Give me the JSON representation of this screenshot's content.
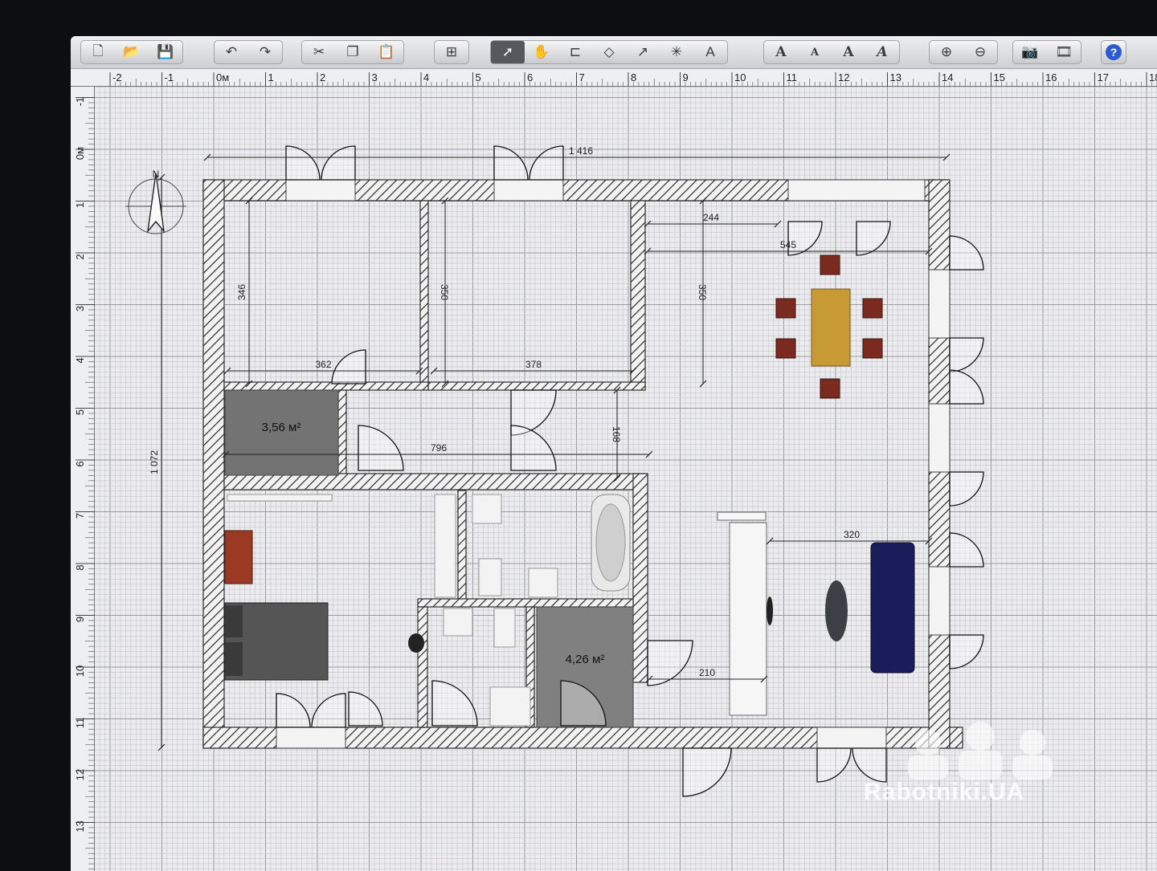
{
  "toolbar": {
    "groups": [
      {
        "name": "file",
        "buttons": [
          {
            "id": "new-plan-button",
            "icon": "new-document-icon",
            "glyph": "🗋"
          },
          {
            "id": "open-button",
            "icon": "folder-icon",
            "glyph": "📂"
          },
          {
            "id": "save-button",
            "icon": "save-icon",
            "glyph": "💾"
          }
        ]
      },
      {
        "name": "history",
        "buttons": [
          {
            "id": "undo-button",
            "icon": "undo-icon",
            "glyph": "↶"
          },
          {
            "id": "redo-button",
            "icon": "redo-icon",
            "glyph": "↷"
          }
        ]
      },
      {
        "name": "clipboard",
        "buttons": [
          {
            "id": "cut-button",
            "icon": "scissors-icon",
            "glyph": "✂"
          },
          {
            "id": "copy-button",
            "icon": "copy-icon",
            "glyph": "❐"
          },
          {
            "id": "paste-button",
            "icon": "paste-icon",
            "glyph": "📋"
          }
        ]
      },
      {
        "name": "furniture",
        "buttons": [
          {
            "id": "add-furniture-button",
            "icon": "add-furniture-icon",
            "glyph": "⊞"
          }
        ]
      },
      {
        "name": "modes",
        "buttons": [
          {
            "id": "select-mode-button",
            "icon": "arrow-cursor-icon",
            "glyph": "➚",
            "selected": true
          },
          {
            "id": "pan-mode-button",
            "icon": "hand-icon",
            "glyph": "✋"
          },
          {
            "id": "create-walls-button",
            "icon": "create-walls-icon",
            "glyph": "⊏"
          },
          {
            "id": "create-rooms-button",
            "icon": "create-rooms-icon",
            "glyph": "◇"
          },
          {
            "id": "create-polylines-button",
            "icon": "create-polylines-icon",
            "glyph": "↗"
          },
          {
            "id": "create-dimensions-button",
            "icon": "create-dimensions-icon",
            "glyph": "✳"
          },
          {
            "id": "add-text-button",
            "icon": "add-text-icon",
            "glyph": "A"
          }
        ]
      },
      {
        "name": "text",
        "buttons": [
          {
            "id": "increase-text-size-button",
            "icon": "text-larger-icon",
            "glyph": "A"
          },
          {
            "id": "decrease-text-size-button",
            "icon": "text-smaller-icon",
            "glyph": "A"
          },
          {
            "id": "bold-text-button",
            "icon": "bold-icon",
            "glyph": "A"
          },
          {
            "id": "italic-text-button",
            "icon": "italic-icon",
            "glyph": "A"
          }
        ]
      },
      {
        "name": "zoom",
        "buttons": [
          {
            "id": "zoom-in-button",
            "icon": "zoom-in-icon",
            "glyph": "⊕"
          },
          {
            "id": "zoom-out-button",
            "icon": "zoom-out-icon",
            "glyph": "⊖"
          }
        ]
      },
      {
        "name": "view",
        "buttons": [
          {
            "id": "create-photo-button",
            "icon": "camera-icon",
            "glyph": "📷"
          },
          {
            "id": "create-video-button",
            "icon": "video-icon",
            "glyph": "🎞"
          }
        ]
      },
      {
        "name": "help",
        "buttons": [
          {
            "id": "help-button",
            "icon": "help-icon",
            "glyph": "?"
          }
        ]
      }
    ]
  },
  "rulers": {
    "horizontal_labels": [
      "-2",
      "-1",
      "0м",
      "1",
      "2",
      "3",
      "4",
      "5",
      "6",
      "7",
      "8",
      "9",
      "10",
      "11",
      "12",
      "13",
      "14",
      "15",
      "16",
      "17",
      "18"
    ],
    "vertical_labels": [
      "-1",
      "0м",
      "1",
      "2",
      "3",
      "4",
      "5",
      "6",
      "7",
      "8",
      "9",
      "10",
      "11",
      "12",
      "13"
    ]
  },
  "dimensions": {
    "overall_width": "1 416",
    "overall_height": "1 072",
    "bedroom1_width": "362",
    "bedroom1_depth": "346",
    "bedroom2_width": "378",
    "bedroom2_depth": "350",
    "living_depth": "350",
    "living_short": "244",
    "living_width": "545",
    "hall_width": "796",
    "hall_depth": "168",
    "lounge_width": "320",
    "entry_width": "210"
  },
  "rooms": {
    "closet_area": "3,56 м²",
    "storage_area": "4,26 м²"
  },
  "compass": {
    "label": "N"
  },
  "colors": {
    "wall_hatch": "#2b2b2b",
    "grid_line": "#b9bbc0",
    "closet_fill": "#737373",
    "storage_fill": "#808080",
    "table_fill": "#c79a33",
    "chair_fill": "#7a2a1e",
    "sofa_fill": "#1a1d5a",
    "bed_fill": "#555555",
    "dresser_fill": "#9a3a25"
  },
  "watermark": {
    "text": "Rabotniki.UA"
  }
}
